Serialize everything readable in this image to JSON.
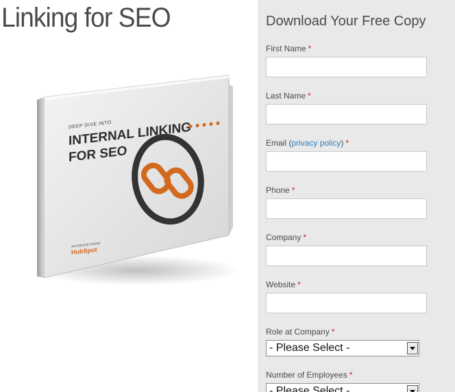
{
  "page": {
    "title": "Linking for SEO"
  },
  "cover": {
    "kicker": "DEEP DIVE INTO",
    "title_line1": "INTERNAL LINKING",
    "title_line2": "FOR SEO",
    "publisher_small": "AN EBOOK FROM",
    "publisher": "HubSpot",
    "colors": {
      "accent": "#d2691e",
      "ring": "#333333",
      "text": "#2e2e2e"
    },
    "icon": "chain-link-icon"
  },
  "form": {
    "heading": "Download Your Free Copy",
    "required_mark": "*",
    "fields": [
      {
        "label": "First Name",
        "type": "text",
        "value": ""
      },
      {
        "label": "Last Name",
        "type": "text",
        "value": ""
      },
      {
        "label_before": "Email (",
        "link": "privacy policy",
        "label_after": ")",
        "type": "text",
        "value": ""
      },
      {
        "label": "Phone",
        "type": "text",
        "value": ""
      },
      {
        "label": "Company",
        "type": "text",
        "value": ""
      },
      {
        "label": "Website",
        "type": "text",
        "value": ""
      },
      {
        "label": "Role at Company",
        "type": "select",
        "selected": "- Please Select -"
      },
      {
        "label": "Number of Employees",
        "type": "select",
        "selected": "- Please Select -"
      }
    ]
  },
  "colors": {
    "panel_bg": "#e9e9e9",
    "required": "#cc2222",
    "link": "#2f7fbf"
  }
}
